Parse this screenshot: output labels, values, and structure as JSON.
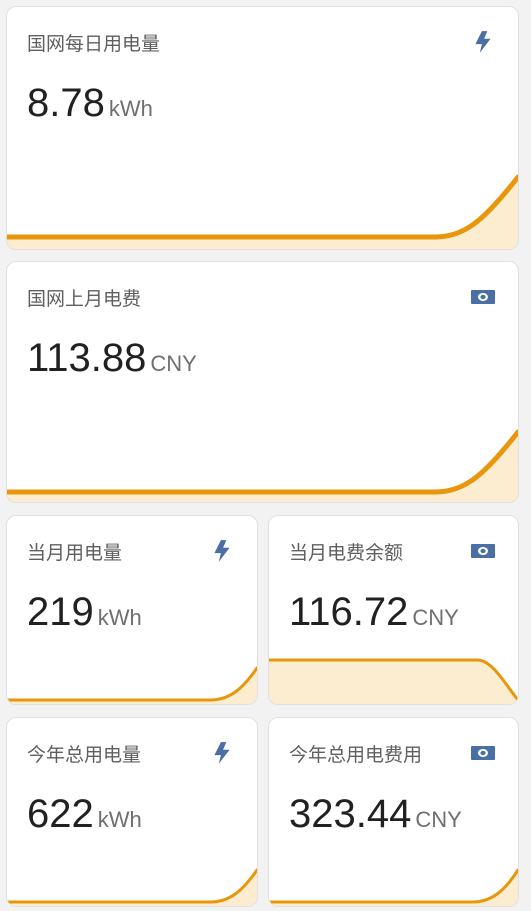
{
  "colors": {
    "accent": "#e8960c",
    "fill": "#fcecd0",
    "icon": "#4a6fa5"
  },
  "cards": [
    {
      "name": "国网每日用电量",
      "value": "8.78",
      "unit": "kWh",
      "icon": "lightning-bolt-icon"
    },
    {
      "name": "国网上月电费",
      "value": "113.88",
      "unit": "CNY",
      "icon": "cash-icon"
    },
    {
      "name": "当月用电量",
      "value": "219",
      "unit": "kWh",
      "icon": "lightning-bolt-icon"
    },
    {
      "name": "当月电费余额",
      "value": "116.72",
      "unit": "CNY",
      "icon": "cash-icon"
    },
    {
      "name": "今年总用电量",
      "value": "622",
      "unit": "kWh",
      "icon": "lightning-bolt-icon"
    },
    {
      "name": "今年总用电费用",
      "value": "323.44",
      "unit": "CNY",
      "icon": "cash-icon"
    }
  ]
}
